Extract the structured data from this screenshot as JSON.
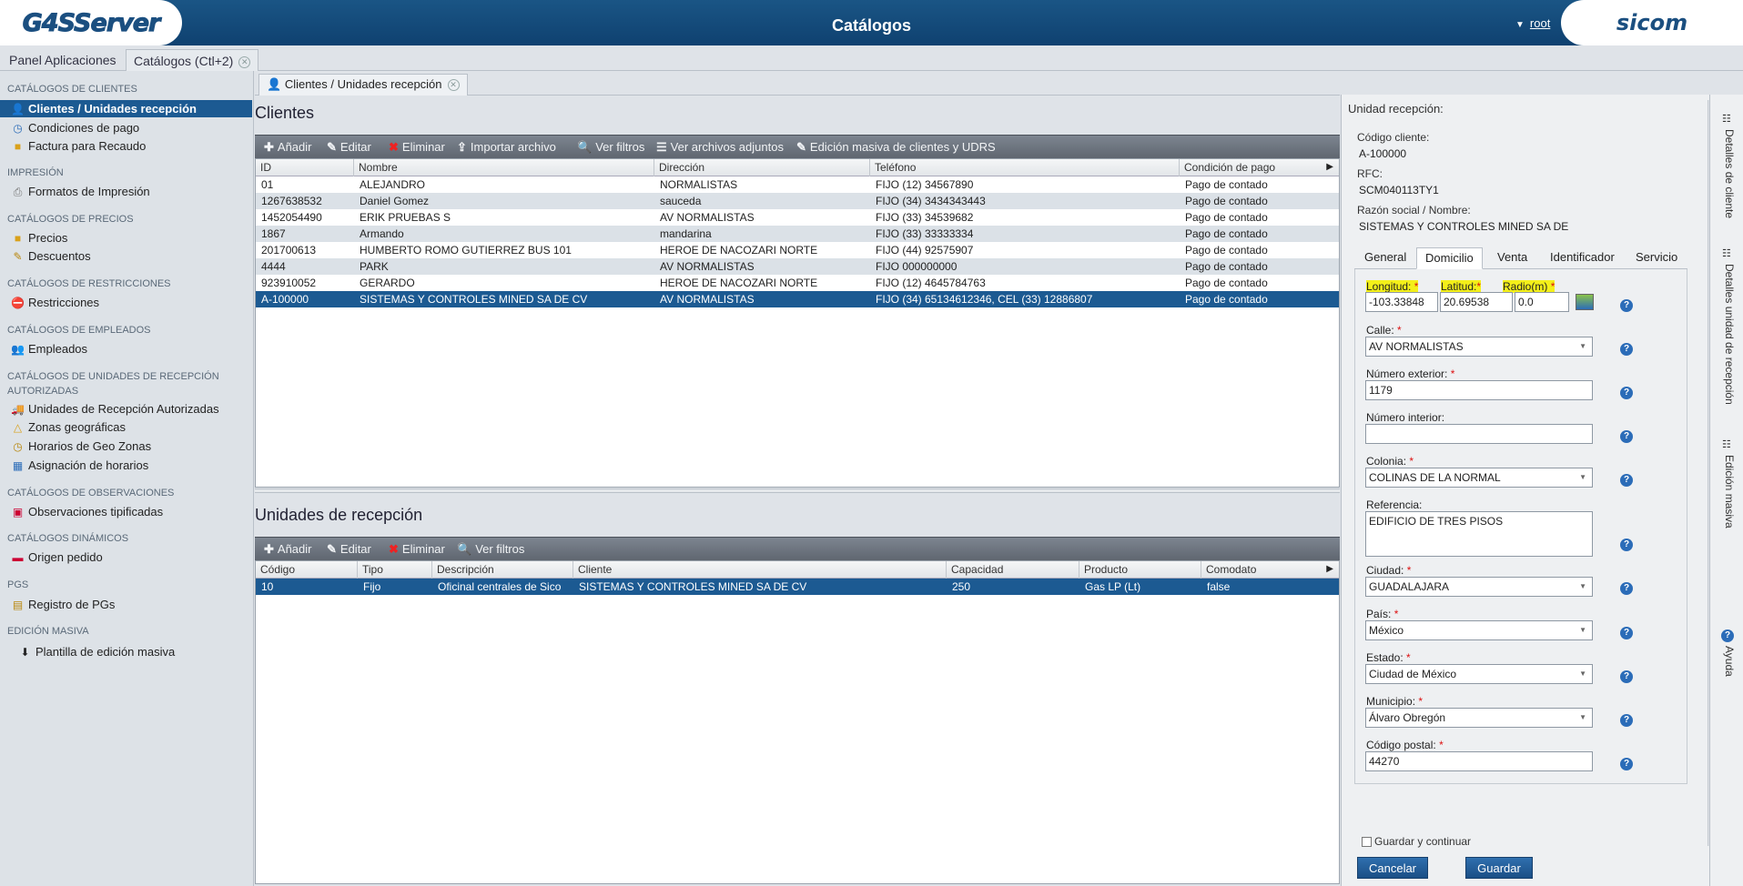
{
  "header": {
    "logo_left": "G4SServer",
    "title": "Catálogos",
    "user": "root",
    "logo_right": "sicom"
  },
  "top_tabs": [
    {
      "label": "Panel Aplicaciones"
    },
    {
      "label": "Catálogos (Ctl+2)"
    }
  ],
  "sidebar": {
    "sections": [
      {
        "title": "CATÁLOGOS DE CLIENTES",
        "items": [
          {
            "label": "Clientes / Unidades recepción",
            "icon": "user-icon"
          },
          {
            "label": "Condiciones de pago",
            "icon": "clock-icon"
          },
          {
            "label": "Factura para Recaudo",
            "icon": "folder-icon"
          }
        ]
      },
      {
        "title": "IMPRESIÓN",
        "items": [
          {
            "label": "Formatos de Impresión",
            "icon": "print-icon"
          }
        ]
      },
      {
        "title": "CATÁLOGOS DE PRECIOS",
        "items": [
          {
            "label": "Precios",
            "icon": "folder-icon"
          },
          {
            "label": "Descuentos",
            "icon": "tag-icon"
          }
        ]
      },
      {
        "title": "CATÁLOGOS DE RESTRICCIONES",
        "items": [
          {
            "label": "Restricciones",
            "icon": "stop-icon"
          }
        ]
      },
      {
        "title": "CATÁLOGOS DE EMPLEADOS",
        "items": [
          {
            "label": "Empleados",
            "icon": "users-icon"
          }
        ]
      },
      {
        "title": "CATÁLOGOS DE UNIDADES DE RECEPCIÓN AUTORIZADAS",
        "items": [
          {
            "label": "Unidades de Recepción Autorizadas",
            "icon": "truck-icon"
          },
          {
            "label": "Zonas geográficas",
            "icon": "zone-icon"
          },
          {
            "label": "Horarios de Geo Zonas",
            "icon": "clock-icon"
          },
          {
            "label": "Asignación de horarios",
            "icon": "calendar-icon"
          }
        ]
      },
      {
        "title": "CATÁLOGOS DE OBSERVACIONES",
        "items": [
          {
            "label": "Observaciones tipificadas",
            "icon": "note-icon"
          }
        ]
      },
      {
        "title": "CATÁLOGOS DINÁMICOS",
        "items": [
          {
            "label": "Origen pedido",
            "icon": "flag-icon"
          }
        ]
      },
      {
        "title": "PGS",
        "items": [
          {
            "label": "Registro de PGs",
            "icon": "doc-icon"
          }
        ]
      },
      {
        "title": "EDICIÓN MASIVA",
        "items": [
          {
            "label": "Plantilla de edición masiva",
            "icon": "download-icon"
          }
        ]
      }
    ]
  },
  "sub_tab": "Clientes / Unidades recepción",
  "clientes": {
    "title": "Clientes",
    "toolbar": {
      "add": "Añadir",
      "edit": "Editar",
      "delete": "Eliminar",
      "import": "Importar archivo",
      "filters": "Ver filtros",
      "attachments": "Ver archivos adjuntos",
      "bulk": "Edición masiva de clientes y UDRS"
    },
    "columns": [
      "ID",
      "Nombre",
      "Dirección",
      "Teléfono",
      "Condición de pago"
    ],
    "rows": [
      [
        "01",
        "ALEJANDRO",
        "NORMALISTAS",
        "FIJO (12) 34567890",
        "Pago de contado"
      ],
      [
        "1267638532",
        "Daniel Gomez",
        "sauceda",
        "FIJO (34) 3434343443",
        "Pago de contado"
      ],
      [
        "1452054490",
        "ERIK PRUEBAS S",
        "AV NORMALISTAS",
        "FIJO (33) 34539682",
        "Pago de contado"
      ],
      [
        "1867",
        "Armando",
        "mandarina",
        "FIJO (33) 33333334",
        "Pago de contado"
      ],
      [
        "201700613",
        "HUMBERTO ROMO GUTIERREZ BUS 101",
        "HEROE DE NACOZARI NORTE",
        "FIJO (44) 92575907",
        "Pago de contado"
      ],
      [
        "4444",
        "PARK",
        "AV NORMALISTAS",
        "FIJO 000000000",
        "Pago de contado"
      ],
      [
        "923910052",
        "GERARDO",
        "HEROE DE NACOZARI NORTE",
        "FIJO (12) 4645784763",
        "Pago de contado"
      ],
      [
        "A-100000",
        "SISTEMAS Y CONTROLES MINED SA DE CV",
        "AV NORMALISTAS",
        "FIJO (34) 65134612346, CEL (33) 12886807",
        "Pago de contado"
      ]
    ]
  },
  "unidades": {
    "title": "Unidades de recepción",
    "toolbar": {
      "add": "Añadir",
      "edit": "Editar",
      "delete": "Eliminar",
      "filters": "Ver filtros"
    },
    "columns": [
      "Código",
      "Tipo",
      "Descripción",
      "Cliente",
      "Capacidad",
      "Producto",
      "Comodato"
    ],
    "rows": [
      [
        "10",
        "Fijo",
        "Oficinal centrales de Sico",
        "SISTEMAS Y CONTROLES MINED SA DE CV",
        "250",
        "Gas LP (Lt)",
        "false"
      ]
    ]
  },
  "detail": {
    "title": "Unidad recepción:",
    "codigo_label": "Código cliente:",
    "codigo": "A-100000",
    "rfc_label": "RFC:",
    "rfc": "SCM040113TY1",
    "razon_label": "Razón social / Nombre:",
    "razon": "SISTEMAS Y CONTROLES MINED SA DE",
    "tabs": [
      "General",
      "Domicilio",
      "Venta",
      "Identificador",
      "Servicio"
    ],
    "longitud_label": "Longitud:",
    "longitud": "-103.33848",
    "latitud_label": "Latitud:",
    "latitud": "20.69538",
    "radio_label": "Radio(m)",
    "radio": "0.0",
    "calle_label": "Calle:",
    "calle": "AV NORMALISTAS",
    "num_ext_label": "Número exterior:",
    "num_ext": "1179",
    "num_int_label": "Número interior:",
    "num_int": "",
    "colonia_label": "Colonia:",
    "colonia": "COLINAS DE LA NORMAL",
    "referencia_label": "Referencia:",
    "referencia": "EDIFICIO DE TRES PISOS",
    "ciudad_label": "Ciudad:",
    "ciudad": "GUADALAJARA",
    "pais_label": "País:",
    "pais": "México",
    "estado_label": "Estado:",
    "estado": "Ciudad de México",
    "municipio_label": "Municipio:",
    "municipio": "Álvaro Obregón",
    "cp_label": "Código postal:",
    "cp": "44270",
    "guardar_continuar": "Guardar y continuar",
    "cancel": "Cancelar",
    "save": "Guardar",
    "required_mark": "*"
  },
  "right_tabs": [
    "Detalles de cliente",
    "Detalles unidad de recepción",
    "Edición masiva",
    "Ayuda"
  ]
}
